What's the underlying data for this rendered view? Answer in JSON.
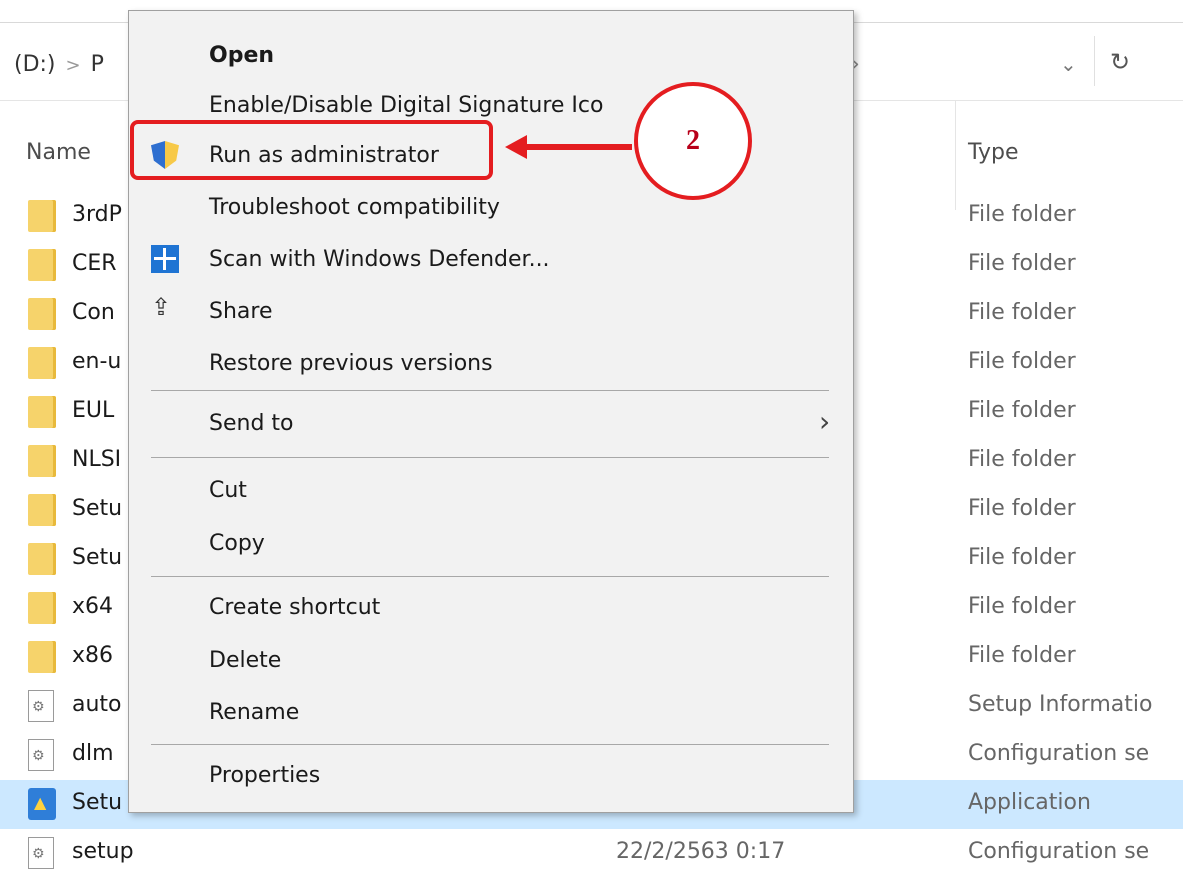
{
  "address_bar": {
    "drive": "(D:)",
    "separator": ">",
    "crumb": "P",
    "history_icon": "chevron-down",
    "refresh_icon": "refresh"
  },
  "columns": {
    "name": "Name",
    "type": "Type"
  },
  "files": [
    {
      "name": "3rdP",
      "type": "File folder",
      "icon": "folder"
    },
    {
      "name": "CER",
      "type": "File folder",
      "icon": "folder"
    },
    {
      "name": "Con",
      "type": "File folder",
      "icon": "folder"
    },
    {
      "name": "en-u",
      "type": "File folder",
      "icon": "folder"
    },
    {
      "name": "EUL",
      "type": "File folder",
      "icon": "folder"
    },
    {
      "name": "NLSI",
      "type": "File folder",
      "icon": "folder"
    },
    {
      "name": "Setu",
      "type": "File folder",
      "icon": "folder"
    },
    {
      "name": "Setu",
      "type": "File folder",
      "icon": "folder"
    },
    {
      "name": "x64",
      "type": "File folder",
      "icon": "folder"
    },
    {
      "name": "x86",
      "type": "File folder",
      "icon": "folder"
    },
    {
      "name": "auto",
      "type": "Setup Informatio",
      "icon": "settings-file"
    },
    {
      "name": "dlm",
      "type": "Configuration se",
      "icon": "settings-file"
    },
    {
      "name": "Setu",
      "type": "Application",
      "icon": "application",
      "selected": true
    },
    {
      "name": "setup",
      "date": "22/2/2563 0:17",
      "type": "Configuration se",
      "icon": "settings-file"
    }
  ],
  "context_menu": {
    "open": "Open",
    "digital_signature": "Enable/Disable Digital Signature Ico",
    "run_as_admin": "Run as administrator",
    "troubleshoot": "Troubleshoot compatibility",
    "scan_defender": "Scan with Windows Defender...",
    "share": "Share",
    "restore_versions": "Restore previous versions",
    "send_to": "Send to",
    "cut": "Cut",
    "copy": "Copy",
    "create_shortcut": "Create shortcut",
    "delete": "Delete",
    "rename": "Rename",
    "properties": "Properties"
  },
  "annotation": {
    "step_number": "2",
    "color": "#e41d20"
  }
}
